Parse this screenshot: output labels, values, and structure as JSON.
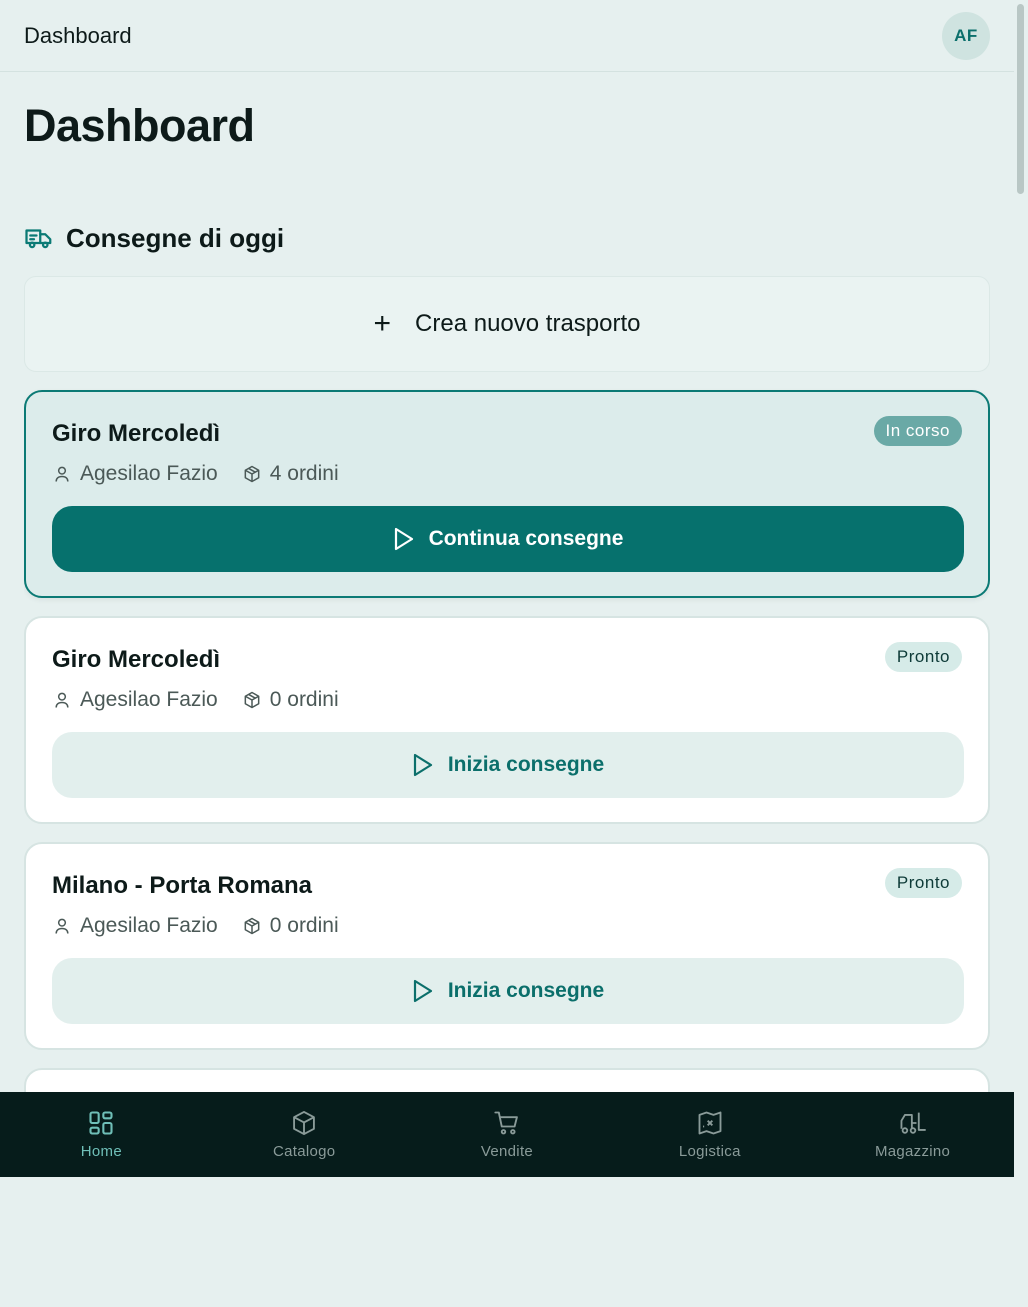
{
  "topbar": {
    "title": "Dashboard",
    "avatar_initials": "AF"
  },
  "page": {
    "title": "Dashboard"
  },
  "section": {
    "title": "Consegne di oggi",
    "icon": "truck-icon"
  },
  "create": {
    "label": "Crea nuovo trasporto",
    "icon": "plus-icon"
  },
  "cards": [
    {
      "title": "Giro Mercoledì",
      "status": "In corso",
      "driver": "Agesilao Fazio",
      "orders": "4 ordini",
      "action": "Continua consegne"
    },
    {
      "title": "Giro Mercoledì",
      "status": "Pronto",
      "driver": "Agesilao Fazio",
      "orders": "0 ordini",
      "action": "Inizia consegne"
    },
    {
      "title": "Milano - Porta Romana",
      "status": "Pronto",
      "driver": "Agesilao Fazio",
      "orders": "0 ordini",
      "action": "Inizia consegne"
    }
  ],
  "nav": [
    {
      "label": "Home",
      "icon": "home-grid-icon",
      "active": true
    },
    {
      "label": "Catalogo",
      "icon": "box-icon"
    },
    {
      "label": "Vendite",
      "icon": "cart-icon"
    },
    {
      "label": "Logistica",
      "icon": "map-icon"
    },
    {
      "label": "Magazzino",
      "icon": "forklift-icon"
    }
  ],
  "colors": {
    "accent": "#06716d",
    "nav_bg": "#061c1b",
    "page_bg": "#e6f0ef"
  }
}
